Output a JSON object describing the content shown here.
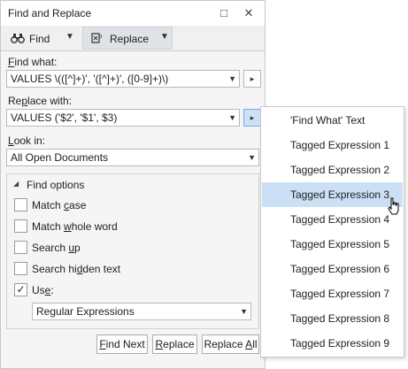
{
  "window": {
    "title": "Find and Replace",
    "restore_glyph": "□",
    "close_glyph": "✕"
  },
  "toolbar": {
    "find_tab": {
      "label": "Find",
      "icon": "binoculars-icon"
    },
    "replace_tab": {
      "label": "Replace",
      "icon": "replace-icon"
    }
  },
  "find_what": {
    "label_u": "F",
    "label_rest": "ind what:",
    "value": "VALUES \\(([^]+)', '([^]+)', ([0-9]+)\\)"
  },
  "replace_with": {
    "label_pre": "Re",
    "label_u": "p",
    "label_rest": "lace with:",
    "value": "VALUES ('$2', '$1', $3)"
  },
  "look_in": {
    "label_u": "L",
    "label_rest": "ook in:",
    "value": "All Open Documents"
  },
  "find_options": {
    "header": "Find options",
    "match_case": {
      "pre": "Match ",
      "u": "c",
      "post": "ase",
      "checked": false
    },
    "match_whole_word": {
      "pre": "Match ",
      "u": "w",
      "post": "hole word",
      "checked": false
    },
    "search_up": {
      "pre": "Search ",
      "u": "u",
      "post": "p",
      "checked": false
    },
    "search_hidden": {
      "pre": "Search hi",
      "u": "d",
      "post": "den text",
      "checked": false
    },
    "use": {
      "pre": "Us",
      "u": "e",
      "post": ":",
      "checked": true,
      "check_glyph": "✓"
    },
    "use_value": "Regular Expressions"
  },
  "buttons": {
    "find_next": {
      "u": "F",
      "rest": "ind Next"
    },
    "replace": {
      "u": "R",
      "rest": "eplace"
    },
    "replace_all": {
      "pre": "Replace ",
      "u": "A",
      "post": "ll"
    }
  },
  "popup_menu": {
    "items": [
      "'Find What' Text",
      "Tagged Expression 1",
      "Tagged Expression 2",
      "Tagged Expression 3",
      "Tagged Expression 4",
      "Tagged Expression 5",
      "Tagged Expression 6",
      "Tagged Expression 7",
      "Tagged Expression 8",
      "Tagged Expression 9"
    ],
    "highlighted": "Tagged Expression 3"
  },
  "glyphs": {
    "caret_down": "▼",
    "caret_right": "▸",
    "options_caret": "◢"
  },
  "colors": {
    "highlight": "#cce0f5",
    "pressed": "#cde0f7"
  }
}
